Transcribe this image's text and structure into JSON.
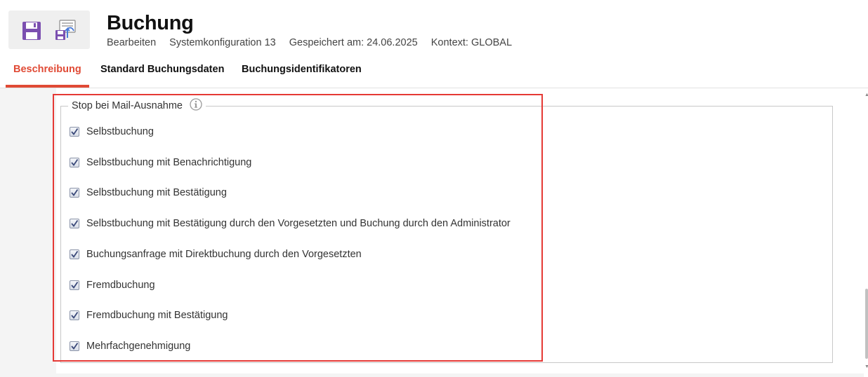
{
  "header": {
    "title": "Buchung",
    "meta": [
      "Bearbeiten",
      "Systemkonfiguration 13",
      "Gespeichert am: 24.06.2025",
      "Kontext: GLOBAL"
    ]
  },
  "toolbar": {
    "icons": [
      "floppy-disk-icon",
      "save-as-icon"
    ],
    "accent": "#7b4fb0"
  },
  "tabs": [
    {
      "label": "Beschreibung",
      "active": true
    },
    {
      "label": "Standard Buchungsdaten",
      "active": false
    },
    {
      "label": "Buchungsidentifikatoren",
      "active": false
    }
  ],
  "group": {
    "legend": "Stop bei Mail-Ausnahme",
    "info_icon": "info-circle-icon",
    "options": [
      {
        "label": "Selbstbuchung",
        "checked": true
      },
      {
        "label": "Selbstbuchung mit Benachrichtigung",
        "checked": true
      },
      {
        "label": "Selbstbuchung mit Bestätigung",
        "checked": true
      },
      {
        "label": "Selbstbuchung mit Bestätigung durch den Vorgesetzten und Buchung durch den Administrator",
        "checked": true
      },
      {
        "label": "Buchungsanfrage mit Direktbuchung durch den Vorgesetzten",
        "checked": true
      },
      {
        "label": "Fremdbuchung",
        "checked": true
      },
      {
        "label": "Fremdbuchung mit Bestätigung",
        "checked": true
      },
      {
        "label": "Mehrfachgenehmigung",
        "checked": true
      }
    ]
  },
  "colors": {
    "active_tab": "#e04a35",
    "highlight": "#e53935",
    "checkmark": "#3b4a7a"
  }
}
